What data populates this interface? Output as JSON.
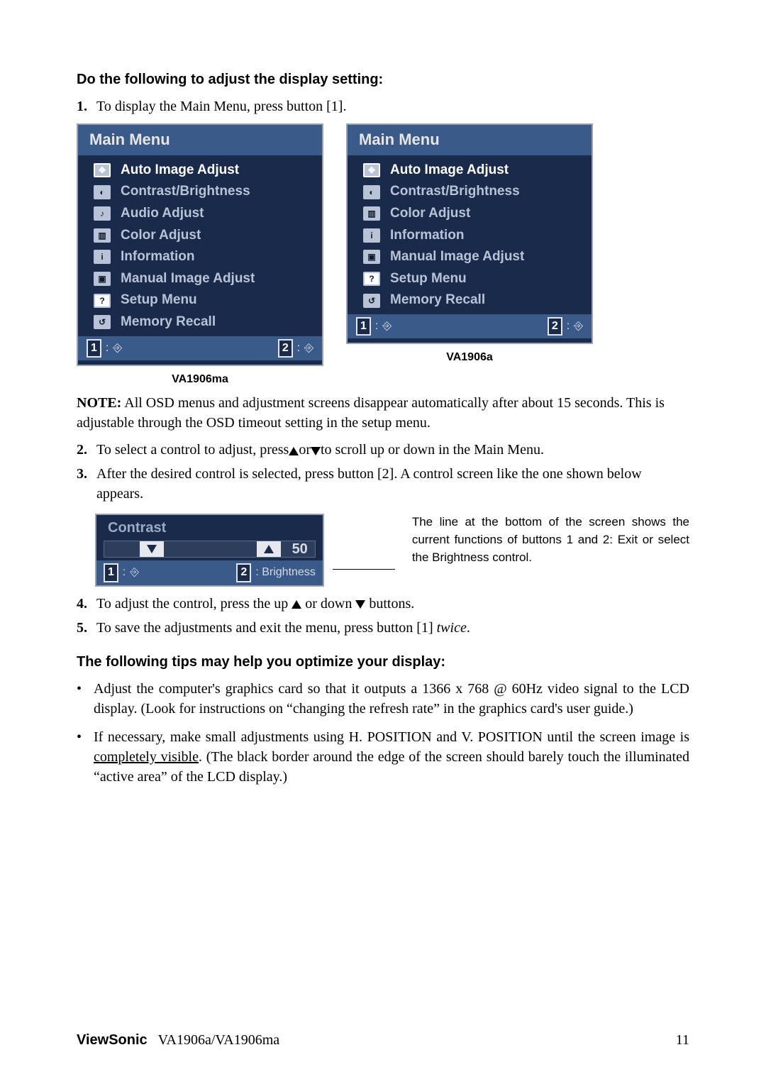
{
  "headings": {
    "adjust": "Do the following to adjust the display setting:",
    "tips": "The following tips may help you optimize your display:"
  },
  "steps": {
    "1": "To display the Main Menu, press button [1].",
    "2": {
      "pre": "To select a control to adjust, press",
      "mid": "or",
      "post": "to scroll up or down in the Main Menu."
    },
    "3": "After the desired control is selected, press button [2]. A control screen like the one shown below appears.",
    "4": {
      "pre": "To adjust the control, press the up ",
      "mid": " or down ",
      "post": " buttons."
    },
    "5": {
      "pre": "To save the adjustments and exit the menu, press button [1] ",
      "twice": "twice",
      "post": "."
    }
  },
  "menus": {
    "ma": {
      "title": "Main Menu",
      "items": [
        "Auto Image Adjust",
        "Contrast/Brightness",
        "Audio Adjust",
        "Color Adjust",
        "Information",
        "Manual Image Adjust",
        "Setup Menu",
        "Memory Recall"
      ],
      "footer": {
        "k1": "1",
        "k2": "2",
        "glyph1": "⎆",
        "glyph2": "⎆"
      },
      "model": "VA1906ma"
    },
    "a": {
      "title": "Main Menu",
      "items": [
        "Auto Image Adjust",
        "Contrast/Brightness",
        "Color Adjust",
        "Information",
        "Manual Image Adjust",
        "Setup Menu",
        "Memory Recall"
      ],
      "footer": {
        "k1": "1",
        "k2": "2",
        "glyph1": "⎆",
        "glyph2": "⎆"
      },
      "model": "VA1906a"
    }
  },
  "note": {
    "label": "NOTE:",
    "text": "All OSD menus and adjustment screens disappear automatically after about 15 seconds. This is adjustable through the OSD timeout setting in the setup menu."
  },
  "contrast": {
    "title": "Contrast",
    "value": "50",
    "footer_k1": "1",
    "footer_glyph1": "⎆",
    "footer_k2": "2",
    "footer_label2": ": Brightness"
  },
  "annotation": "The line at the bottom of the screen shows the current functions of buttons 1 and 2: Exit or select the Brightness control.",
  "tips": {
    "1": {
      "pre": "Adjust the computer's graphics card so that it outputs a 1366 x 768 ",
      "at": "@",
      "post": " 60Hz video signal to the LCD display. (Look for instructions on “changing the refresh rate” in the graphics card's user guide.)"
    },
    "2": {
      "pre": "If necessary, make small adjustments using H. POSITION and V. POSITION until the screen image is ",
      "underline": "completely visible",
      "post": ". (The black border around the edge of the screen should barely touch the illuminated “active area” of the LCD display.)"
    }
  },
  "footer": {
    "brand": "ViewSonic",
    "model": "VA1906a/VA1906ma",
    "page": "11"
  }
}
